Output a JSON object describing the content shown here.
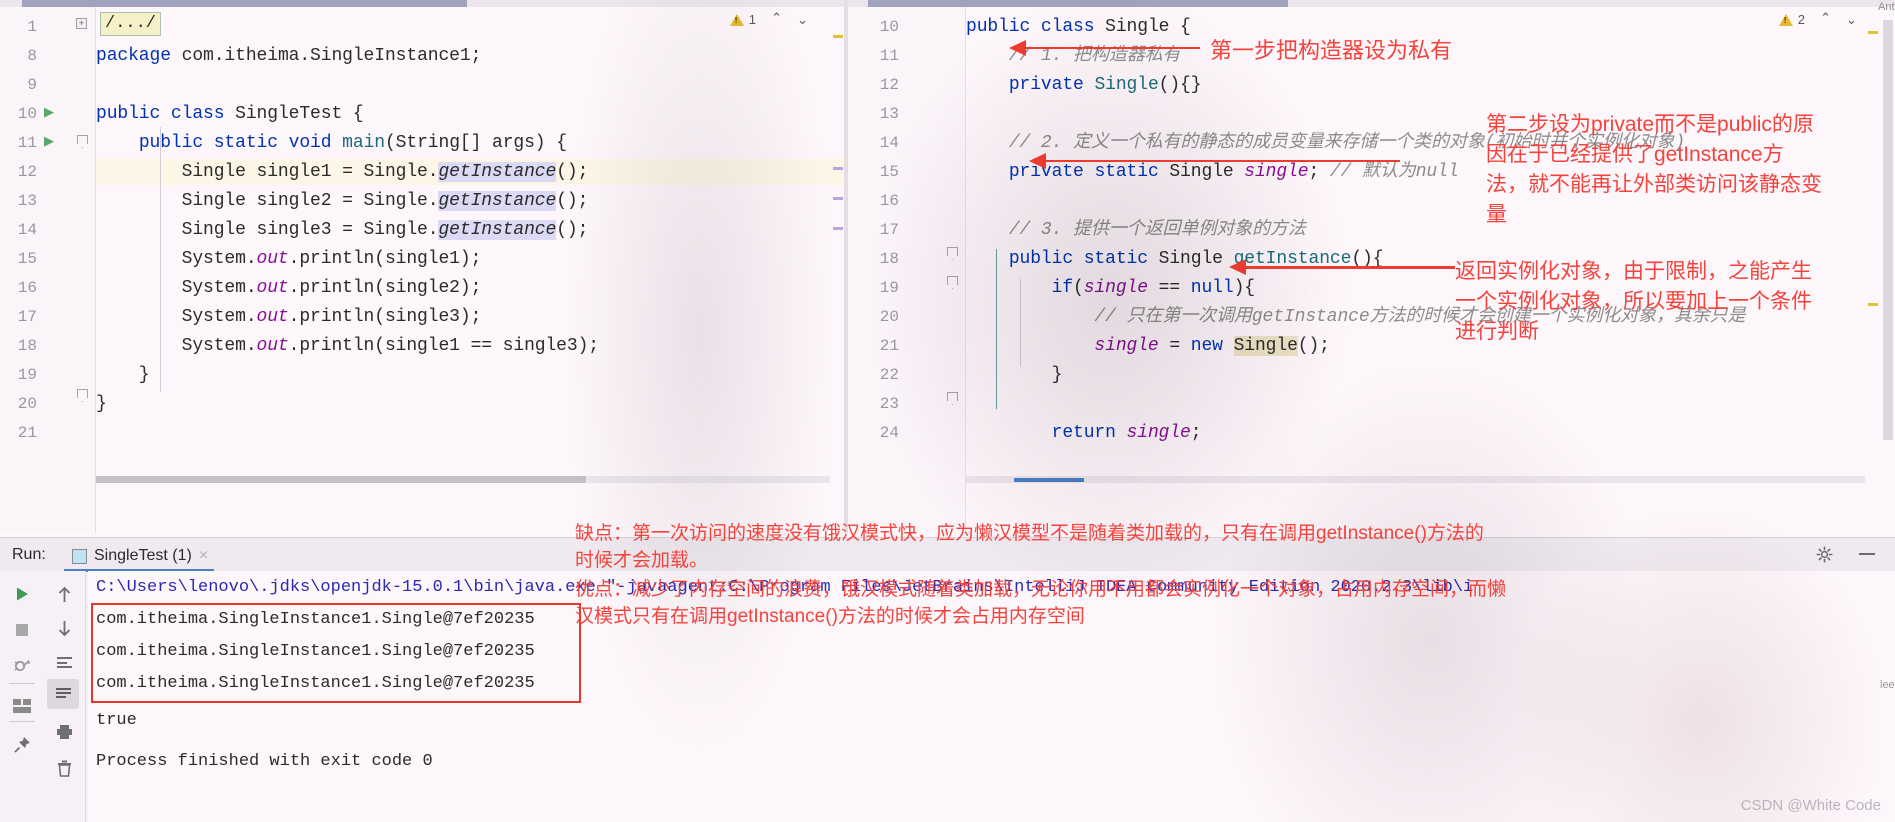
{
  "editor_left": {
    "fold_chip": "/.../",
    "warning_count": "1",
    "line_numbers": [
      "1",
      "8",
      "9",
      "10",
      "11",
      "12",
      "13",
      "14",
      "15",
      "16",
      "17",
      "18",
      "19",
      "20",
      "21"
    ],
    "lines": [
      "package com.itheima.SingleInstance1;",
      "",
      "public class SingleTest {",
      "    public static void main(String[] args) {",
      "        Single single1 = Single.getInstance();",
      "        Single single2 = Single.getInstance();",
      "        Single single3 = Single.getInstance();",
      "        System.out.println(single1);",
      "        System.out.println(single2);",
      "        System.out.println(single3);",
      "        System.out.println(single1 == single3);",
      "    }",
      "}"
    ]
  },
  "editor_right": {
    "warning_count": "2",
    "line_numbers": [
      "10",
      "11",
      "12",
      "13",
      "14",
      "15",
      "16",
      "17",
      "18",
      "19",
      "20",
      "21",
      "22",
      "23",
      "24"
    ],
    "lines": [
      "public class Single {",
      "    // 1. 把构造器私有",
      "    private Single(){}",
      "",
      "    // 2. 定义一个私有的静态的成员变量来存储一个类的对象(初始时并个实例化对象)",
      "    private static Single single; // 默认为null",
      "",
      "    // 3. 提供一个返回单例对象的方法",
      "    public static Single getInstance(){",
      "        if(single == null){",
      "            // 只在第一次调用getInstance方法的时候才会创建一个实例化对象，其余只是",
      "            single = new Single();",
      "        }",
      "",
      "        return single;"
    ]
  },
  "annotations": {
    "step1": "第一步把构造器设为私有",
    "step2_line1": "第二步设为private而不是public的原",
    "step2_line2": "因在于已经提供了getInstance方",
    "step2_line3": "法，就不能再让外部类访问该静态变",
    "step2_line4": "量",
    "step3_line1": "返回实例化对象，由于限制，之能产生",
    "step3_line2": "一个实例化对象，所以要加上一个条件",
    "step3_line3": "进行判断",
    "console_line1": "缺点：第一次访问的速度没有饿汉模式快，应为懒汉模型不是随着类加载的，只有在调用getInstance()方法的",
    "console_line2": "时候才会加载。",
    "console_line3": "优点：减少了内存空间的浪费，饿汉模式随着类加载，无论你用不用都会实例化一个对象，占用内存空间，而懒",
    "console_line4": "汉模式只有在调用getInstance()方法的时候才会占用内存空间"
  },
  "run_panel": {
    "label": "Run:",
    "tab_title": "SingleTest (1)",
    "tab_close": "×",
    "console": {
      "command": "C:\\Users\\lenovo\\.jdks\\openjdk-15.0.1\\bin\\java.exe \"-javaagent:C:\\Program Files\\JetBrains\\IntelliJ IDEA Community Edition 2020.2.3\\lib\\i",
      "out1": "com.itheima.SingleInstance1.Single@7ef20235",
      "out2": "com.itheima.SingleInstance1.Single@7ef20235",
      "out3": "com.itheima.SingleInstance1.Single@7ef20235",
      "out4": "true",
      "out5": "Process finished with exit code 0"
    },
    "tools": [
      {
        "name": "rerun-button",
        "glyph": "▶"
      },
      {
        "name": "stop-button",
        "glyph": "■"
      },
      {
        "name": "debug-button",
        "glyph": "🐞"
      },
      {
        "name": "layout-button",
        "glyph": "▤"
      },
      {
        "name": "pin-button",
        "glyph": "📌"
      },
      {
        "name": "scroll-up-button",
        "glyph": "↑"
      },
      {
        "name": "scroll-down-button",
        "glyph": "↓"
      },
      {
        "name": "soft-wrap-button",
        "glyph": "⇥"
      },
      {
        "name": "scroll-to-end-button",
        "glyph": "⇟"
      },
      {
        "name": "print-button",
        "glyph": "🖨"
      },
      {
        "name": "trash-button",
        "glyph": "🗑"
      }
    ]
  },
  "watermark": "CSDN @White Code",
  "side_tag_top": "Ant",
  "side_tag_right": "leetcode"
}
